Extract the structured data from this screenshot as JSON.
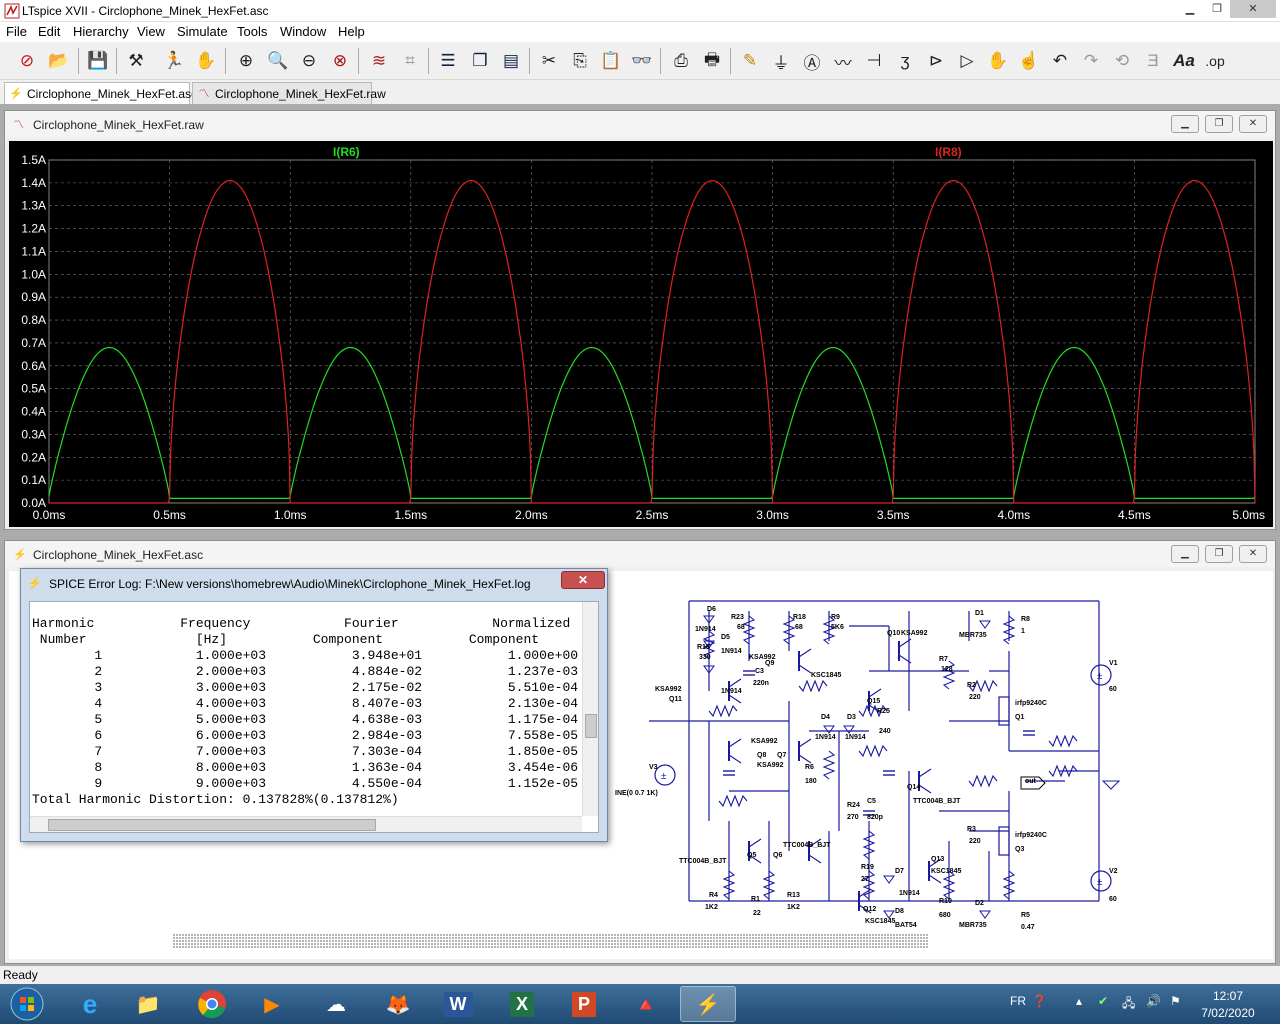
{
  "window": {
    "title": "LTspice XVII - Circlophone_Minek_HexFet.asc"
  },
  "menu": [
    "File",
    "Edit",
    "Hierarchy",
    "View",
    "Simulate",
    "Tools",
    "Window",
    "Help"
  ],
  "toolbar_icons": [
    "new-schematic-icon",
    "open-icon",
    "save-icon",
    "control-panel-icon",
    "run-icon",
    "halt-icon",
    "zoom-in-icon",
    "zoom-pan-icon",
    "zoom-out-icon",
    "zoom-fit-icon",
    "autorange-icon",
    "plot-settings-icon",
    "tile-horizontal-icon",
    "cascade-icon",
    "tile-vertical-icon",
    "cut-icon",
    "copy-icon",
    "paste-icon",
    "find-icon",
    "print-icon",
    "print-setup-icon",
    "draw-wire-icon",
    "ground-icon",
    "label-net-icon",
    "resistor-icon",
    "capacitor-icon",
    "inductor-icon",
    "diode-icon",
    "component-icon",
    "move-icon",
    "drag-icon",
    "undo-icon",
    "redo-icon",
    "rotate-icon",
    "mirror-icon",
    "text-icon",
    "spice-directive-icon"
  ],
  "tabs": [
    {
      "label": "Circlophone_Minek_HexFet.asc",
      "icon": "schematic-icon"
    },
    {
      "label": "Circlophone_Minek_HexFet.raw",
      "icon": "waveform-icon"
    }
  ],
  "waveform_window": {
    "title": "Circlophone_Minek_HexFet.raw"
  },
  "schematic_window": {
    "title": "Circlophone_Minek_HexFet.asc"
  },
  "chart_data": {
    "type": "line",
    "x": [
      0.0,
      0.05,
      0.1,
      0.15,
      0.2,
      0.25,
      0.3,
      0.35,
      0.4,
      0.45,
      0.5
    ],
    "yticks": [
      "1.5A",
      "1.4A",
      "1.3A",
      "1.2A",
      "1.1A",
      "1.0A",
      "0.9A",
      "0.8A",
      "0.7A",
      "0.6A",
      "0.5A",
      "0.4A",
      "0.3A",
      "0.2A",
      "0.1A",
      "0.0A"
    ],
    "xticks": [
      "0.0ms",
      "0.5ms",
      "1.0ms",
      "1.5ms",
      "2.0ms",
      "2.5ms",
      "3.0ms",
      "3.5ms",
      "4.0ms",
      "4.5ms",
      "5.0ms"
    ],
    "xlim": [
      0,
      5.0
    ],
    "ylim": [
      0,
      1.5
    ],
    "grid": true,
    "series": [
      {
        "name": "I(R6)",
        "color": "#22dd22",
        "peak": 0.68,
        "phase": "positive",
        "period_ms": 1.0
      },
      {
        "name": "I(R8)",
        "color": "#dd2222",
        "peak": 1.41,
        "phase": "negative",
        "period_ms": 1.0
      }
    ]
  },
  "error_log": {
    "title": "SPICE Error Log: F:\\New versions\\homebrew\\Audio\\Minek\\Circlophone_Minek_HexFet.log",
    "close_label": "✕",
    "header1": [
      "Harmonic",
      "Frequency",
      "Fourier",
      "Normalized"
    ],
    "header2": [
      "Number",
      "[Hz]",
      "Component",
      "Component"
    ],
    "rows": [
      [
        "1",
        "1.000e+03",
        "3.948e+01",
        "1.000e+00"
      ],
      [
        "2",
        "2.000e+03",
        "4.884e-02",
        "1.237e-03"
      ],
      [
        "3",
        "3.000e+03",
        "2.175e-02",
        "5.510e-04"
      ],
      [
        "4",
        "4.000e+03",
        "8.407e-03",
        "2.130e-04"
      ],
      [
        "5",
        "5.000e+03",
        "4.638e-03",
        "1.175e-04"
      ],
      [
        "6",
        "6.000e+03",
        "2.984e-03",
        "7.558e-05"
      ],
      [
        "7",
        "7.000e+03",
        "7.303e-04",
        "1.850e-05"
      ],
      [
        "8",
        "8.000e+03",
        "1.363e-04",
        "3.454e-06"
      ],
      [
        "9",
        "9.000e+03",
        "4.550e-04",
        "1.152e-05"
      ]
    ],
    "thd": "Total Harmonic Distortion: 0.137828%(0.137812%)"
  },
  "schematic_labels": [
    {
      "t": "D6"
    },
    {
      "t": "R23"
    },
    {
      "t": "68"
    },
    {
      "t": "R18"
    },
    {
      "t": "68"
    },
    {
      "t": "R9"
    },
    {
      "t": "5K6"
    },
    {
      "t": "Q10"
    },
    {
      "t": "KSA992"
    },
    {
      "t": "D1"
    },
    {
      "t": "MBR735"
    },
    {
      "t": "R8"
    },
    {
      "t": "1"
    },
    {
      "t": "1N914"
    },
    {
      "t": "D5"
    },
    {
      "t": "1N914"
    },
    {
      "t": "R16"
    },
    {
      "t": "330"
    },
    {
      "t": "KSA992"
    },
    {
      "t": "Q9"
    },
    {
      "t": "C3"
    },
    {
      "t": "KSC1845"
    },
    {
      "t": "R7"
    },
    {
      "t": "128"
    },
    {
      "t": "V1"
    },
    {
      "t": "KSA992"
    },
    {
      "t": "Q11"
    },
    {
      "t": "1N914"
    },
    {
      "t": "220n"
    },
    {
      "t": "Q15"
    },
    {
      "t": "R2"
    },
    {
      "t": "220"
    },
    {
      "t": "irfp9240C"
    },
    {
      "t": "Q1"
    },
    {
      "t": "60"
    },
    {
      "t": "D4"
    },
    {
      "t": "D3"
    },
    {
      "t": "R25"
    },
    {
      "t": "1N914"
    },
    {
      "t": "1N914"
    },
    {
      "t": "240"
    },
    {
      "t": "KSA992"
    },
    {
      "t": "Q8"
    },
    {
      "t": "Q7"
    },
    {
      "t": "KSA992"
    },
    {
      "t": "V3"
    },
    {
      "t": "INE(0 0.7 1K)"
    },
    {
      "t": "R6"
    },
    {
      "t": "180"
    },
    {
      "t": "Q14"
    },
    {
      "t": "out"
    },
    {
      "t": "R24"
    },
    {
      "t": "270"
    },
    {
      "t": "C5"
    },
    {
      "t": "820p"
    },
    {
      "t": "TTC004B_BJT"
    },
    {
      "t": "R3"
    },
    {
      "t": "220"
    },
    {
      "t": "irfp9240C"
    },
    {
      "t": "Q3"
    },
    {
      "t": "TTC004B_BJT"
    },
    {
      "t": "TTC004B_BJT"
    },
    {
      "t": "Q5"
    },
    {
      "t": "Q6"
    },
    {
      "t": "R19"
    },
    {
      "t": "27"
    },
    {
      "t": "D7"
    },
    {
      "t": "Q13"
    },
    {
      "t": "KSC1845"
    },
    {
      "t": "1N914"
    },
    {
      "t": "V2"
    },
    {
      "t": "60"
    },
    {
      "t": "R4"
    },
    {
      "t": "1K2"
    },
    {
      "t": "R1"
    },
    {
      "t": "22"
    },
    {
      "t": "R13"
    },
    {
      "t": "1K2"
    },
    {
      "t": "Q12"
    },
    {
      "t": "KSC1845"
    },
    {
      "t": "D8"
    },
    {
      "t": "BAT54"
    },
    {
      "t": "R10"
    },
    {
      "t": "680"
    },
    {
      "t": "D2"
    },
    {
      "t": "MBR735"
    },
    {
      "t": "R5"
    },
    {
      "t": "0.47"
    }
  ],
  "status": {
    "text": "Ready"
  },
  "taskbar": {
    "apps": [
      "start-orb-icon",
      "internet-explorer-icon",
      "file-explorer-icon",
      "chrome-icon",
      "media-player-icon",
      "onedrive-icon",
      "firefox-icon",
      "word-icon",
      "excel-icon",
      "powerpoint-icon",
      "vlc-icon",
      "ltspice-icon"
    ],
    "lang": "FR",
    "time": "12:07",
    "date": "7/02/2020"
  }
}
